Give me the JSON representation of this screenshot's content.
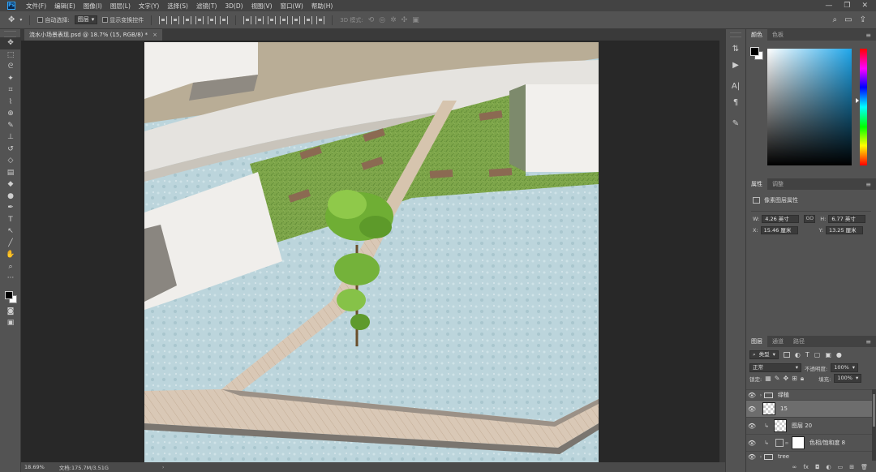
{
  "app": {
    "logo": "Ps",
    "menu": [
      "文件(F)",
      "编辑(E)",
      "图像(I)",
      "图层(L)",
      "文字(Y)",
      "选择(S)",
      "滤镜(T)",
      "3D(D)",
      "视图(V)",
      "窗口(W)",
      "帮助(H)"
    ],
    "window_controls": [
      "—",
      "❐",
      "✕"
    ]
  },
  "options_bar": {
    "auto_select_label": "自动选择:",
    "auto_select_value": "图层",
    "show_transform_label": "显示变换控件",
    "mode3d_label": "3D 模式:"
  },
  "document": {
    "tab_title": "流水小场景表现.psd @ 18.7% (15, RGB/8) *",
    "close": "×"
  },
  "status_bar": {
    "zoom": "18.69%",
    "doc_info": "文档:175.7M/3.51G",
    "arrow": "›"
  },
  "color_panel": {
    "tabs": [
      "颜色",
      "色板"
    ],
    "fg_color": "#000000",
    "bg_color": "#ffffff",
    "hue_color": "#1fa6ea"
  },
  "properties_panel": {
    "tabs": [
      "属性",
      "调整"
    ],
    "title": "像素图层属性",
    "w_label": "W:",
    "w_value": "4.26 英寸",
    "h_label": "H:",
    "h_value": "6.77 英寸",
    "x_label": "X:",
    "x_value": "15.46 厘米",
    "y_label": "Y:",
    "y_value": "13.25 厘米",
    "link_symbol": "GO"
  },
  "layers_panel": {
    "tabs": [
      "图层",
      "通道",
      "路径"
    ],
    "filter_kind": "类型",
    "blend_mode": "正常",
    "opacity_label": "不透明度:",
    "opacity_value": "100%",
    "lock_label": "锁定:",
    "fill_label": "填充:",
    "fill_value": "100%",
    "layers": [
      {
        "name": "绿植",
        "type": "group"
      },
      {
        "name": "15",
        "type": "pixel",
        "selected": true
      },
      {
        "name": "图层 20",
        "type": "pixel"
      },
      {
        "name": "色相/饱和度 8",
        "type": "adjustment"
      },
      {
        "name": "tree",
        "type": "group"
      }
    ],
    "footer_icons": [
      "∞",
      "fx",
      "◘",
      "◐",
      "▭",
      "⊞",
      "🗑"
    ]
  }
}
